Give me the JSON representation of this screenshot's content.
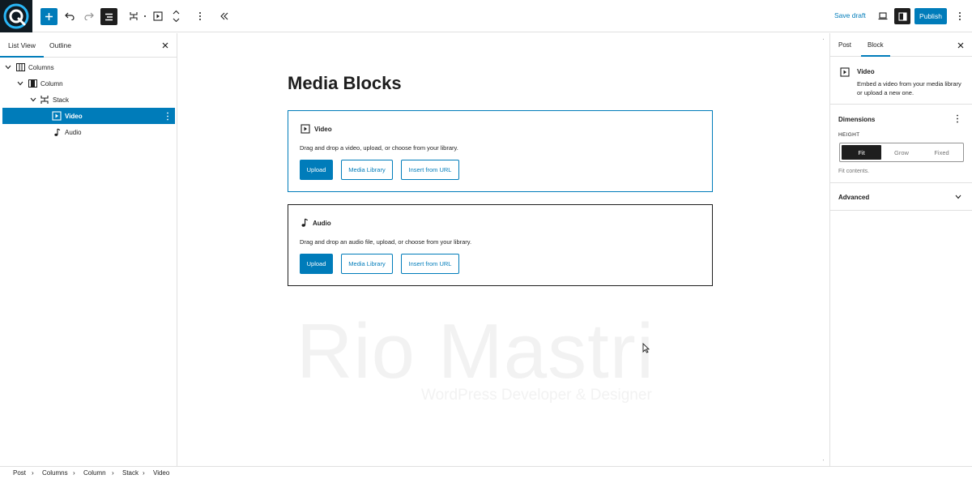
{
  "toolbar": {
    "save_draft": "Save draft",
    "publish": "Publish"
  },
  "list_view": {
    "tabs": [
      "List View",
      "Outline"
    ],
    "items": [
      {
        "label": "Columns"
      },
      {
        "label": "Column"
      },
      {
        "label": "Stack"
      },
      {
        "label": "Video"
      },
      {
        "label": "Audio"
      }
    ]
  },
  "canvas": {
    "title": "Media Blocks",
    "video_block": {
      "heading": "Video",
      "description": "Drag and drop a video, upload, or choose from your library.",
      "upload": "Upload",
      "media_library": "Media Library",
      "insert_url": "Insert from URL"
    },
    "audio_block": {
      "heading": "Audio",
      "description": "Drag and drop an audio file, upload, or choose from your library.",
      "upload": "Upload",
      "media_library": "Media Library",
      "insert_url": "Insert from URL"
    },
    "watermark": "Rio Mastri",
    "watermark_sub": "WordPress Developer & Designer"
  },
  "inspector": {
    "tabs": [
      "Post",
      "Block"
    ],
    "block_title": "Video",
    "block_description": "Embed a video from your media library or upload a new one.",
    "dimensions": "Dimensions",
    "height_label": "HEIGHT",
    "height_options": [
      "Fit",
      "Grow",
      "Fixed"
    ],
    "height_selected": "Fit",
    "help": "Fit contents.",
    "advanced": "Advanced"
  },
  "breadcrumb": [
    "Post",
    "Columns",
    "Column",
    "Stack",
    "Video"
  ],
  "colors": {
    "accent": "#007cba",
    "dark": "#1e1e1e",
    "border": "#e0e0e0"
  }
}
